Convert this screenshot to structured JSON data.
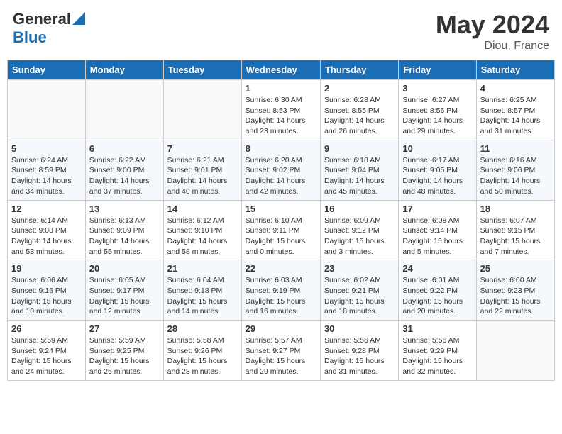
{
  "header": {
    "logo_general": "General",
    "logo_blue": "Blue",
    "month_year": "May 2024",
    "location": "Diou, France"
  },
  "days_of_week": [
    "Sunday",
    "Monday",
    "Tuesday",
    "Wednesday",
    "Thursday",
    "Friday",
    "Saturday"
  ],
  "weeks": [
    [
      {
        "day": "",
        "info": ""
      },
      {
        "day": "",
        "info": ""
      },
      {
        "day": "",
        "info": ""
      },
      {
        "day": "1",
        "info": "Sunrise: 6:30 AM\nSunset: 8:53 PM\nDaylight: 14 hours\nand 23 minutes."
      },
      {
        "day": "2",
        "info": "Sunrise: 6:28 AM\nSunset: 8:55 PM\nDaylight: 14 hours\nand 26 minutes."
      },
      {
        "day": "3",
        "info": "Sunrise: 6:27 AM\nSunset: 8:56 PM\nDaylight: 14 hours\nand 29 minutes."
      },
      {
        "day": "4",
        "info": "Sunrise: 6:25 AM\nSunset: 8:57 PM\nDaylight: 14 hours\nand 31 minutes."
      }
    ],
    [
      {
        "day": "5",
        "info": "Sunrise: 6:24 AM\nSunset: 8:59 PM\nDaylight: 14 hours\nand 34 minutes."
      },
      {
        "day": "6",
        "info": "Sunrise: 6:22 AM\nSunset: 9:00 PM\nDaylight: 14 hours\nand 37 minutes."
      },
      {
        "day": "7",
        "info": "Sunrise: 6:21 AM\nSunset: 9:01 PM\nDaylight: 14 hours\nand 40 minutes."
      },
      {
        "day": "8",
        "info": "Sunrise: 6:20 AM\nSunset: 9:02 PM\nDaylight: 14 hours\nand 42 minutes."
      },
      {
        "day": "9",
        "info": "Sunrise: 6:18 AM\nSunset: 9:04 PM\nDaylight: 14 hours\nand 45 minutes."
      },
      {
        "day": "10",
        "info": "Sunrise: 6:17 AM\nSunset: 9:05 PM\nDaylight: 14 hours\nand 48 minutes."
      },
      {
        "day": "11",
        "info": "Sunrise: 6:16 AM\nSunset: 9:06 PM\nDaylight: 14 hours\nand 50 minutes."
      }
    ],
    [
      {
        "day": "12",
        "info": "Sunrise: 6:14 AM\nSunset: 9:08 PM\nDaylight: 14 hours\nand 53 minutes."
      },
      {
        "day": "13",
        "info": "Sunrise: 6:13 AM\nSunset: 9:09 PM\nDaylight: 14 hours\nand 55 minutes."
      },
      {
        "day": "14",
        "info": "Sunrise: 6:12 AM\nSunset: 9:10 PM\nDaylight: 14 hours\nand 58 minutes."
      },
      {
        "day": "15",
        "info": "Sunrise: 6:10 AM\nSunset: 9:11 PM\nDaylight: 15 hours\nand 0 minutes."
      },
      {
        "day": "16",
        "info": "Sunrise: 6:09 AM\nSunset: 9:12 PM\nDaylight: 15 hours\nand 3 minutes."
      },
      {
        "day": "17",
        "info": "Sunrise: 6:08 AM\nSunset: 9:14 PM\nDaylight: 15 hours\nand 5 minutes."
      },
      {
        "day": "18",
        "info": "Sunrise: 6:07 AM\nSunset: 9:15 PM\nDaylight: 15 hours\nand 7 minutes."
      }
    ],
    [
      {
        "day": "19",
        "info": "Sunrise: 6:06 AM\nSunset: 9:16 PM\nDaylight: 15 hours\nand 10 minutes."
      },
      {
        "day": "20",
        "info": "Sunrise: 6:05 AM\nSunset: 9:17 PM\nDaylight: 15 hours\nand 12 minutes."
      },
      {
        "day": "21",
        "info": "Sunrise: 6:04 AM\nSunset: 9:18 PM\nDaylight: 15 hours\nand 14 minutes."
      },
      {
        "day": "22",
        "info": "Sunrise: 6:03 AM\nSunset: 9:19 PM\nDaylight: 15 hours\nand 16 minutes."
      },
      {
        "day": "23",
        "info": "Sunrise: 6:02 AM\nSunset: 9:21 PM\nDaylight: 15 hours\nand 18 minutes."
      },
      {
        "day": "24",
        "info": "Sunrise: 6:01 AM\nSunset: 9:22 PM\nDaylight: 15 hours\nand 20 minutes."
      },
      {
        "day": "25",
        "info": "Sunrise: 6:00 AM\nSunset: 9:23 PM\nDaylight: 15 hours\nand 22 minutes."
      }
    ],
    [
      {
        "day": "26",
        "info": "Sunrise: 5:59 AM\nSunset: 9:24 PM\nDaylight: 15 hours\nand 24 minutes."
      },
      {
        "day": "27",
        "info": "Sunrise: 5:59 AM\nSunset: 9:25 PM\nDaylight: 15 hours\nand 26 minutes."
      },
      {
        "day": "28",
        "info": "Sunrise: 5:58 AM\nSunset: 9:26 PM\nDaylight: 15 hours\nand 28 minutes."
      },
      {
        "day": "29",
        "info": "Sunrise: 5:57 AM\nSunset: 9:27 PM\nDaylight: 15 hours\nand 29 minutes."
      },
      {
        "day": "30",
        "info": "Sunrise: 5:56 AM\nSunset: 9:28 PM\nDaylight: 15 hours\nand 31 minutes."
      },
      {
        "day": "31",
        "info": "Sunrise: 5:56 AM\nSunset: 9:29 PM\nDaylight: 15 hours\nand 32 minutes."
      },
      {
        "day": "",
        "info": ""
      }
    ]
  ]
}
